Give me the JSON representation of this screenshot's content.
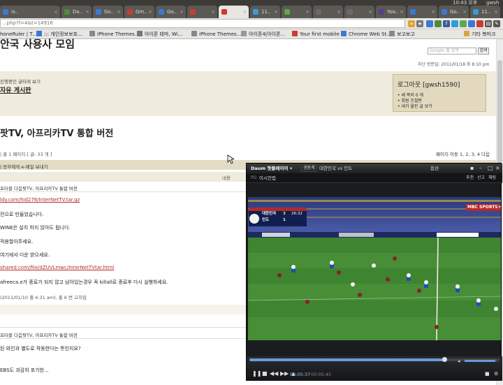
{
  "tabs": [
    {
      "label": "Is..",
      "color": "#3b78d8"
    },
    {
      "label": "Da..",
      "color": "#4f8a3a"
    },
    {
      "label": "Go..",
      "color": "#3b78d8"
    },
    {
      "label": "Gm..",
      "color": "#cc3b2f"
    },
    {
      "label": "Go..",
      "color": "#3b78d8"
    },
    {
      "label": "",
      "color": "#cc3b2f"
    },
    {
      "label": "",
      "color": "#cc3b2f"
    },
    {
      "label": "11..",
      "color": "#3a9ad9"
    },
    {
      "label": "",
      "color": "#5fa84b"
    },
    {
      "label": "",
      "color": "#6a6a6a"
    },
    {
      "label": "",
      "color": "#6a6a6a"
    },
    {
      "label": "Yoo..",
      "color": "#5a3c8c"
    },
    {
      "label": "",
      "color": "#3b78d8"
    },
    {
      "label": "Go..",
      "color": "#3b78d8"
    },
    {
      "label": "11..",
      "color": "#3a9ad9"
    }
  ],
  "system": {
    "clock": "10:43 오후",
    "user": "gwsh"
  },
  "address": {
    "url": "...php?f=4&t=14916"
  },
  "bookmarks": [
    {
      "label": "honeRuler | T...",
      "color": ""
    },
    {
      "label": "::: 개인정보보호...",
      "color": "#3b78d8"
    },
    {
      "label": "iPhone Themes...",
      "color": "#888888"
    },
    {
      "label": "아이폰 테마, Wi...",
      "color": "#777777"
    },
    {
      "label": "iPhone Themes...",
      "color": "#888888"
    },
    {
      "label": "아이폰4|아이폰...",
      "color": "#999999"
    },
    {
      "label": "Your first mobile",
      "color": "#cc3b2f"
    },
    {
      "label": "Chrome Web St...",
      "color": "#3b78d8"
    },
    {
      "label": "보고보고",
      "color": "#888888"
    },
    {
      "label": "기타 북마크",
      "color": "#d9a53b"
    }
  ],
  "site": {
    "title_partial": "안국 사용사 모임",
    "search_placeholder": "Google 웹 검색",
    "search_btn": "검색",
    "last_visit": "지난 방문일: 2011/01/18 화 8:10 pm",
    "board_subtitle": "진행중인 글타래 보기",
    "board_name": "자유 게시판",
    "login": {
      "title": "로그아웃 [gwsh1590]",
      "items": [
        "• 새 쪽지 0 개",
        "• 회원 조절판",
        "• 내가 올린 글 보기"
      ]
    },
    "post_title": "팟TV, 아프리카TV 통합 버전",
    "page_info": "| 총 1 페이지  [ 글: 33 개 ]",
    "pagination": "페이지 이동 1, 2, 3, 4  다음",
    "email_link": "| 동무에게 e-메일 보내기",
    "col_content": "내용",
    "thread_title": "포터블 다음팟TV, 아프리카TV 통합 버전",
    "lines": [
      {
        "text": "ldy.com/hid276/InterNetTV.tar.gz",
        "type": "link"
      },
      {
        "text": "전으로 만들었습니다.",
        "type": "text"
      },
      {
        "text": "WINE은 설치 하지 않아도 됩니다.",
        "type": "text"
      },
      {
        "text": "적용할아주세요.",
        "type": "text"
      },
      {
        "text": "여기에서 다운 받으세요.",
        "type": "text"
      },
      {
        "text": "shared.com/file/dZUVLmwc/InterNetTVtar.html",
        "type": "link"
      },
      {
        "text": "afreeca.e가 종료가 되지 않고 남아있는경우 꼭 killall로 종료후 다시 실행하세요.",
        "type": "text"
      },
      {
        "text": "(2011/01/10 월 4:31 am), 총 6 번 고치임",
        "type": "small"
      }
    ],
    "reply_title": "포터블 다음팟TV, 아프리카TV 통합 버전",
    "reply_lines": [
      "된 와인과 별도로 작동한다는 뜻인지요?",
      "EBS도 과감히 포기한..."
    ]
  },
  "player": {
    "brand": "Daum 팟플레이어",
    "menu": "▾",
    "stream_label": "생중계",
    "match": "대한민국 vs 인도",
    "options": "옵션",
    "channel_left": "PD",
    "channel_name": "이시안컵",
    "sub_buttons": [
      "추천",
      "신고",
      "채팅"
    ],
    "score": {
      "home": "대한민국",
      "home_score": "3",
      "away": "인도",
      "away_score": "1",
      "clock": "26:32"
    },
    "broadcaster": "MBC SPORTS+",
    "time_elapsed": "00:05:37",
    "time_total": "00:05:45",
    "seek_fraction": 0.78,
    "volume_fraction": 0.92
  }
}
